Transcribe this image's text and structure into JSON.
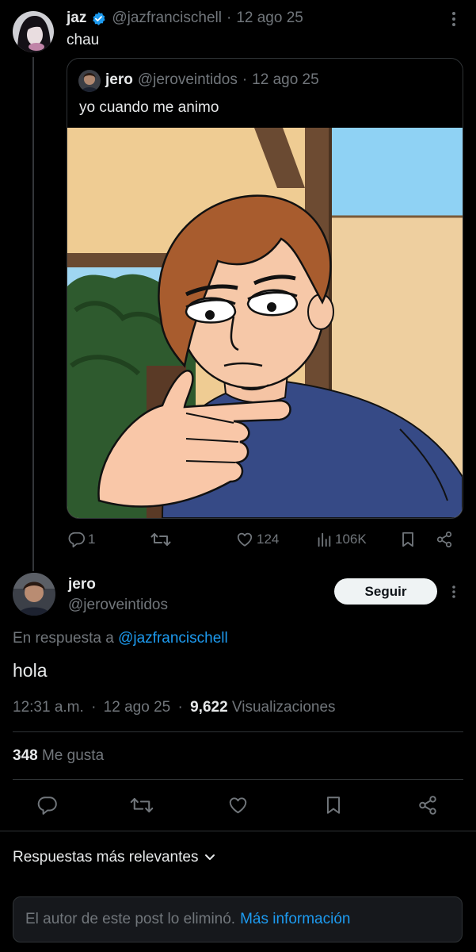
{
  "parent_post": {
    "display_name": "jaz",
    "handle": "@jazfrancischell",
    "separator": "·",
    "date": "12 ago 25",
    "text": "chau",
    "quote": {
      "display_name": "jero",
      "handle": "@jeroveintidos",
      "separator": "·",
      "date": "12 ago 25",
      "text": "yo cuando me animo"
    },
    "actions": {
      "replies": "1",
      "likes": "124",
      "views": "106K"
    }
  },
  "main_post": {
    "display_name": "jero",
    "handle": "@jeroveintidos",
    "follow_label": "Seguir",
    "reply_prefix": "En respuesta a",
    "reply_to": "@jazfrancischell",
    "text": "hola",
    "time": "12:31 a.m.",
    "separator": "·",
    "date": "12 ago 25",
    "separator2": "·",
    "views_count": "9,622",
    "views_label": "Visualizaciones",
    "likes_count": "348",
    "likes_label": "Me gusta"
  },
  "sort_label": "Respuestas más relevantes",
  "deleted_notice": {
    "text": "El autor de este post lo eliminó.",
    "link": "Más información"
  },
  "colors": {
    "accent": "#1d9bf0",
    "secondary_text": "#71767b",
    "divider": "#2f3336",
    "background": "#000000"
  },
  "icons": [
    "verified-badge-icon",
    "more-icon",
    "reply-icon",
    "repost-icon",
    "like-icon",
    "views-icon",
    "bookmark-icon",
    "share-icon",
    "chevron-down-icon"
  ]
}
